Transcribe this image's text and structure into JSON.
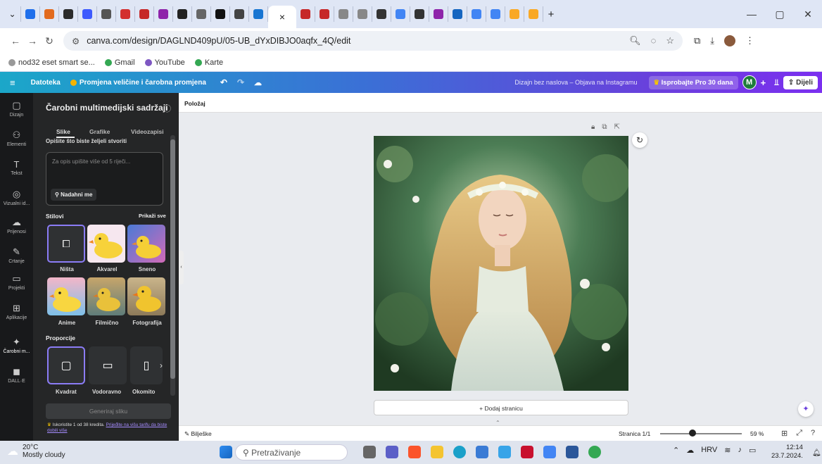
{
  "browser": {
    "tabs": [
      {
        "name": "tab-1",
        "color": "#1f6feb"
      },
      {
        "name": "tab-2",
        "color": "#e26b1f"
      },
      {
        "name": "tab-3",
        "color": "#2b2b2b"
      },
      {
        "name": "tab-4",
        "color": "#3d5afe"
      },
      {
        "name": "tab-5",
        "color": "#555"
      },
      {
        "name": "tab-6",
        "color": "#d32f2f"
      },
      {
        "name": "tab-7",
        "color": "#c62828"
      },
      {
        "name": "tab-8",
        "color": "#8e24aa"
      },
      {
        "name": "tab-9",
        "color": "#222"
      },
      {
        "name": "tab-10",
        "color": "#666"
      },
      {
        "name": "tab-11",
        "color": "#111"
      },
      {
        "name": "tab-12",
        "color": "#444"
      },
      {
        "name": "tab-13",
        "color": "#1976d2"
      }
    ],
    "active_tab_close": "×",
    "tabs_after": [
      {
        "name": "tab-15",
        "color": "#c62828"
      },
      {
        "name": "tab-16",
        "color": "#c62828"
      },
      {
        "name": "tab-17",
        "color": "#888"
      },
      {
        "name": "tab-18",
        "color": "#888"
      },
      {
        "name": "tab-19",
        "color": "#333"
      },
      {
        "name": "tab-20",
        "color": "#4285f4"
      },
      {
        "name": "tab-21",
        "color": "#333"
      },
      {
        "name": "tab-22",
        "color": "#8e24aa"
      },
      {
        "name": "tab-23",
        "color": "#1565c0"
      },
      {
        "name": "tab-24",
        "color": "#4285f4"
      },
      {
        "name": "tab-25",
        "color": "#4285f4"
      },
      {
        "name": "tab-26",
        "color": "#f9a825"
      },
      {
        "name": "tab-27",
        "color": "#f9a825"
      }
    ],
    "new_tab": "+",
    "window": {
      "minimize": "—",
      "restore": "▢",
      "close": "✕"
    },
    "url": "canva.com/design/DAGLND409pU/05-UB_dYxDIBJO0aqfx_4Q/edit",
    "bookmarks": [
      {
        "label": "nod32 eset smart se...",
        "color": "#999"
      },
      {
        "label": "Gmail",
        "color": "#34a853"
      },
      {
        "label": "YouTube",
        "color": "#7e57c2"
      },
      {
        "label": "Karte",
        "color": "#34a853"
      }
    ]
  },
  "canva_bar": {
    "menu_icon": "≡",
    "file": "Datoteka",
    "resize": "Promjena veličine i čarobna promjena",
    "design_title": "Dizajn bez naslova – Objava na Instagramu",
    "pro": "Isprobajte Pro 30 dana",
    "avatar": "M",
    "plus": "+",
    "share": "Dijeli"
  },
  "rail": [
    {
      "icon": "▢",
      "label": "Dizajn"
    },
    {
      "icon": "⚇",
      "label": "Elementi"
    },
    {
      "icon": "T",
      "label": "Tekst"
    },
    {
      "icon": "◎",
      "label": "Vizualni id..."
    },
    {
      "icon": "☁",
      "label": "Prijenosi"
    },
    {
      "icon": "✎",
      "label": "Crtanje"
    },
    {
      "icon": "▭",
      "label": "Projekti"
    },
    {
      "icon": "⊞",
      "label": "Aplikacije"
    },
    {
      "icon": "✦",
      "label": "Čarobni m..."
    },
    {
      "icon": "◼",
      "label": "DALL·E"
    }
  ],
  "panel": {
    "title": "Čarobni multimedijski sadržaji",
    "info": "ⓘ",
    "tabs": [
      "Slike",
      "Grafike",
      "Videozapisi"
    ],
    "prompt_label": "Opišite što biste željeli stvoriti",
    "prompt_placeholder": "Za opis upišite više od 5 riječi...",
    "inspire": "Nadahni me",
    "styles_heading": "Stilovi",
    "styles_all": "Prikaži sve",
    "styles": [
      "Ništa",
      "Akvarel",
      "Sneno",
      "Anime",
      "Filmično",
      "Fotografija"
    ],
    "ratio_heading": "Proporcije",
    "ratios": [
      "Kvadrat",
      "Vodoravno",
      "Okomito"
    ],
    "generate": "Generiraj sliku",
    "credits_text": "Iskoristite 1 od 38 kredita.",
    "credits_link": "Prijeđite na višu tarifu da biste dobili više"
  },
  "editor": {
    "toolbar_label": "Položaj",
    "add_page": "+ Dodaj stranicu",
    "notes": "Bilješke",
    "page_indicator": "Stranica 1/1",
    "zoom": "59 %",
    "zoom_level": 0.4
  },
  "taskbar": {
    "temp": "20°C",
    "weather": "Mostly cloudy",
    "search": "Pretraživanje",
    "lang": "HRV",
    "time": "12:14",
    "date": "23.7.2024."
  }
}
